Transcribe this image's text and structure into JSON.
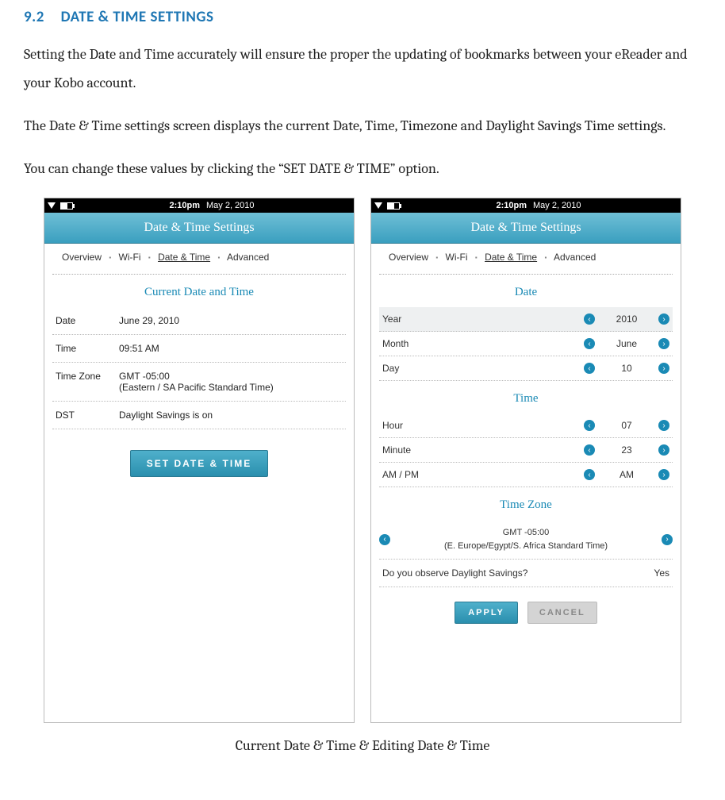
{
  "heading": {
    "number": "9.2",
    "title": "DATE & TIME SETTINGS"
  },
  "paragraphs": {
    "p1": "Setting the Date and Time accurately will ensure the proper the updating of bookmarks between your eReader and your Kobo account.",
    "p2": "The Date & Time settings screen displays the current Date, Time, Timezone and Daylight Savings Time settings.",
    "p3": "You can change these values by clicking the “SET DATE & TIME” option."
  },
  "statusbar": {
    "time": "2:10pm",
    "date": "May 2, 2010"
  },
  "titlebar": "Date & Time Settings",
  "breadcrumbs": {
    "items": [
      "Overview",
      "Wi-Fi",
      "Date & Time",
      "Advanced"
    ],
    "active": "Date & Time",
    "sep": "▪"
  },
  "left": {
    "section": "Current Date and Time",
    "rows": {
      "date": {
        "label": "Date",
        "value": "June 29, 2010"
      },
      "time": {
        "label": "Time",
        "value": "09:51 AM"
      },
      "tz": {
        "label": "Time Zone",
        "value1": "GMT -05:00",
        "value2": "(Eastern / SA Pacific Standard Time)"
      },
      "dst": {
        "label": "DST",
        "value": "Daylight Savings is on"
      }
    },
    "button": "SET DATE & TIME"
  },
  "right": {
    "sections": {
      "date": "Date",
      "time": "Time",
      "tz": "Time Zone"
    },
    "date": {
      "year": {
        "label": "Year",
        "value": "2010"
      },
      "month": {
        "label": "Month",
        "value": "June"
      },
      "day": {
        "label": "Day",
        "value": "10"
      }
    },
    "time": {
      "hour": {
        "label": "Hour",
        "value": "07"
      },
      "minute": {
        "label": "Minute",
        "value": "23"
      },
      "ampm": {
        "label": "AM / PM",
        "value": "AM"
      }
    },
    "tz": {
      "line1": "GMT -05:00",
      "line2": "(E. Europe/Egypt/S. Africa Standard Time)"
    },
    "dst": {
      "question": "Do you observe Daylight Savings?",
      "answer": "Yes"
    },
    "buttons": {
      "apply": "APPLY",
      "cancel": "CANCEL"
    }
  },
  "caption": "Current Date & Time & Editing Date & Time",
  "icons": {
    "left": "‹",
    "right": "›"
  }
}
